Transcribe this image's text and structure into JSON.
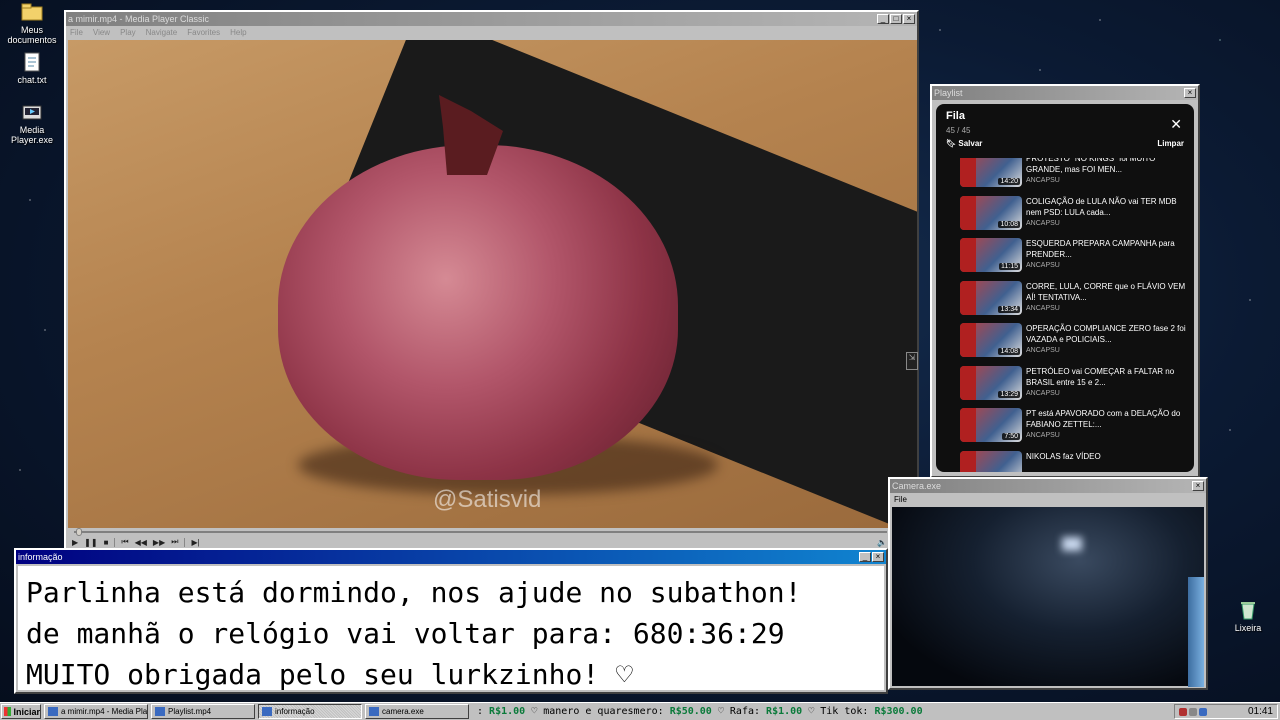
{
  "desktop": {
    "icons": [
      {
        "label": "Meus documentos",
        "icon": "folder-icon"
      },
      {
        "label": "chat.txt",
        "icon": "notepad-icon"
      },
      {
        "label": "Media Player.exe",
        "icon": "media-player-icon"
      },
      {
        "label": "Lixeira",
        "icon": "recycle-bin-icon"
      }
    ]
  },
  "media_player": {
    "title": "a mimir.mp4 - Media Player Classic",
    "menu": [
      "File",
      "View",
      "Play",
      "Navigate",
      "Favorites",
      "Help"
    ],
    "watermark": "@Satisvid",
    "progress": 0.005
  },
  "playlist_window": {
    "title": "Playlist",
    "header": "Fila",
    "count": "45 / 45",
    "save_label": "Salvar",
    "clear_label": "Limpar",
    "items": [
      {
        "title": "PROTESTO \"NO KINGS\" foi MUITO GRANDE, mas FOI MEN...",
        "duration": "14:20",
        "channel": "ANCAPSU"
      },
      {
        "title": "COLIGAÇÃO de LULA NÃO vai TER MDB nem PSD: LULA cada...",
        "duration": "10:08",
        "channel": "ANCAPSU"
      },
      {
        "title": "ESQUERDA PREPARA CAMPANHA para PRENDER...",
        "duration": "11:15",
        "channel": "ANCAPSU"
      },
      {
        "title": "CORRE, LULA, CORRE que o FLÁVIO VEM AÍ! TENTATIVA...",
        "duration": "13:34",
        "channel": "ANCAPSU"
      },
      {
        "title": "OPERAÇÃO COMPLIANCE ZERO fase 2 foi VAZADA e POLICIAIS...",
        "duration": "14:08",
        "channel": "ANCAPSU"
      },
      {
        "title": "PETRÓLEO vai COMEÇAR a FALTAR no BRASIL entre 15 e 2...",
        "duration": "13:29",
        "channel": "ANCAPSU"
      },
      {
        "title": "PT está APAVORADO com a DELAÇÃO do FABIANO ZETTEL:...",
        "duration": "7:50",
        "channel": "ANCAPSU"
      },
      {
        "title": "NIKOLAS faz VÍDEO",
        "duration": "",
        "channel": ""
      }
    ]
  },
  "info_window": {
    "title": "informação",
    "lines": [
      "Parlinha está dormindo, nos ajude no subathon!",
      "de manhã o relógio vai voltar para:  680:36:29",
      "MUITO obrigada pelo seu lurkzinho! ♡"
    ]
  },
  "camera_window": {
    "title": "Camera.exe",
    "menu": "File"
  },
  "taskbar": {
    "start_label": "Iniciar",
    "tasks": [
      {
        "label": "a mimir.mp4 - Media Playe...",
        "pressed": false
      },
      {
        "label": "Playlist.mp4",
        "pressed": false
      },
      {
        "label": "informação",
        "pressed": true
      },
      {
        "label": "camera.exe",
        "pressed": false
      }
    ],
    "ticker": [
      {
        "name": "",
        "amount": "R$1.00"
      },
      {
        "name": "manero e quaresmero:",
        "amount": "R$50.00"
      },
      {
        "name": "Rafa:",
        "amount": "R$1.00"
      },
      {
        "name": "Tik tok:",
        "amount": "R$300.00"
      }
    ],
    "clock": "01:41"
  }
}
